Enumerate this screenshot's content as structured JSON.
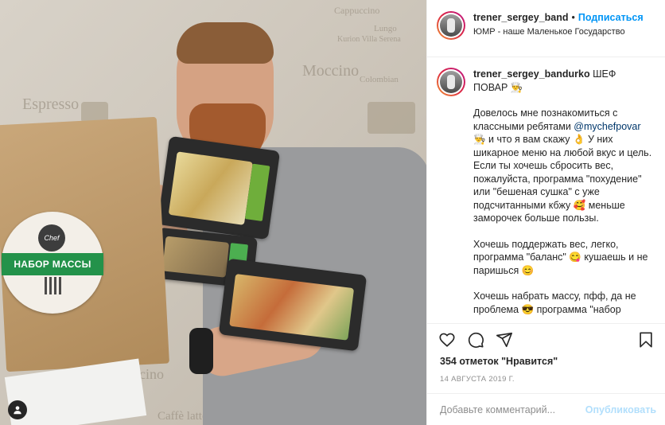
{
  "header": {
    "username": "trener_sergey_band",
    "dot": "•",
    "follow_label": "Подписаться",
    "location": "ЮМР - наше Маленькое Государство"
  },
  "caption": {
    "username": "trener_sergey_bandurko",
    "title": "ШЕФ ПОВАР 👨‍🍳",
    "p1_before": "Довелось мне познакомиться с классными ребятами ",
    "p1_mention": "@mychefpovar",
    "p1_after": " 👨‍🍳 и что я вам скажу 👌 У них шикарное меню на любой вкус и цель. Если ты хочешь сбросить вес, пожалуйста, программа \"похудение\" или \"бешеная сушка\" с уже подсчитанными кбжу 🥰 меньше заморочек больше пользы.",
    "p2": "Хочешь поддержать вес, легко, программа \"баланс\" 😋 кушаешь и не паришься 😊",
    "p3": "Хочешь набрать массу, пфф, да не проблема 😎 программа \"набор"
  },
  "photo": {
    "sticker_text": "НАБОР МАССЫ",
    "sticker_logo": "Chef povar",
    "wall_words": [
      "Espresso",
      "Cappuccino",
      "Caffè latte",
      "Colombian",
      "Cappuccino",
      "Lungo",
      "Kurion Villa Serena",
      "Moccino"
    ]
  },
  "actions": {
    "likes_text": "354 отметок \"Нравится\"",
    "date": "14 АВГУСТА 2019 Г."
  },
  "comment": {
    "placeholder": "Добавьте комментарий...",
    "publish_label": "Опубликовать"
  },
  "icons": {
    "like": "heart-icon",
    "comment": "comment-icon",
    "share": "share-icon",
    "save": "bookmark-icon",
    "tagged_user": "user-icon"
  },
  "colors": {
    "follow_blue": "#0095f6",
    "publish_disabled": "#b2dffc",
    "sticker_green": "#23924a"
  }
}
